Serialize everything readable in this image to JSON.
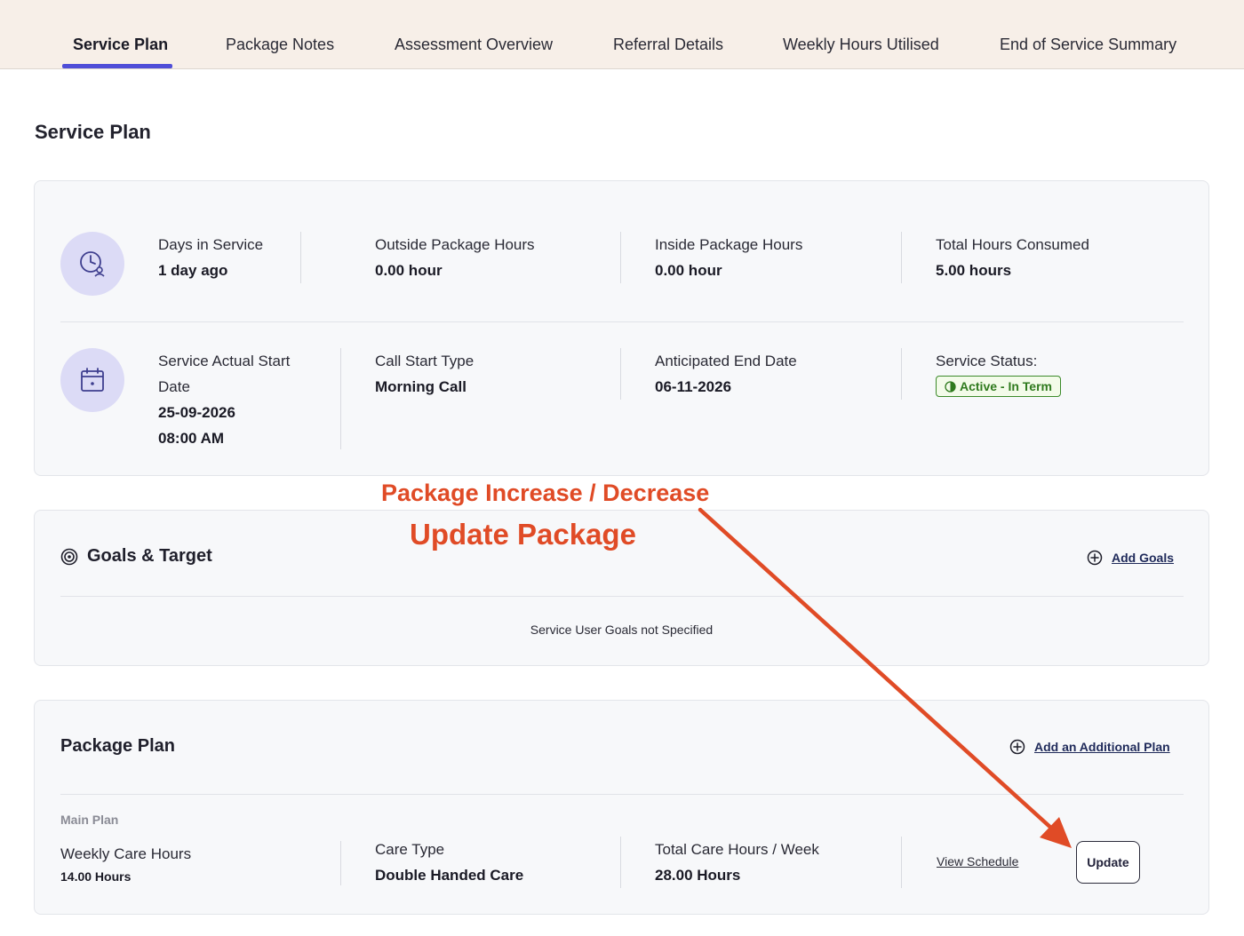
{
  "tabs": [
    {
      "label": "Service Plan",
      "active": true
    },
    {
      "label": "Package Notes",
      "active": false
    },
    {
      "label": "Assessment Overview",
      "active": false
    },
    {
      "label": "Referral Details",
      "active": false
    },
    {
      "label": "Weekly Hours Utilised",
      "active": false
    },
    {
      "label": "End of Service Summary",
      "active": false
    }
  ],
  "page_title": "Service Plan",
  "stats_row1": {
    "days_in_service": {
      "label": "Days in Service",
      "value": "1 day ago"
    },
    "outside_package_hours": {
      "label": "Outside Package Hours",
      "value": "0.00 hour"
    },
    "inside_package_hours": {
      "label": "Inside Package Hours",
      "value": "0.00 hour"
    },
    "total_hours_consumed": {
      "label": "Total Hours Consumed",
      "value": "5.00 hours"
    }
  },
  "stats_row2": {
    "service_actual_start": {
      "label_line1": "Service Actual Start",
      "label_line2": "Date",
      "date": "25-09-2026",
      "time": "08:00 AM"
    },
    "call_start_type": {
      "label": "Call Start Type",
      "value": "Morning Call"
    },
    "anticipated_end_date": {
      "label": "Anticipated End Date",
      "value": "06-11-2026"
    },
    "service_status": {
      "label": "Service Status:",
      "value": "Active - In Term"
    }
  },
  "goals": {
    "title": "Goals & Target",
    "add_label": "Add Goals",
    "empty_text": "Service User Goals not Specified"
  },
  "package_plan": {
    "title": "Package Plan",
    "add_label": "Add an Additional Plan",
    "subhead": "Main Plan",
    "weekly_care_hours": {
      "label": "Weekly Care Hours",
      "value": "14.00 Hours"
    },
    "care_type": {
      "label": "Care Type",
      "value": "Double Handed Care"
    },
    "total_care_hours": {
      "label": "Total Care Hours / Week",
      "value": "28.00 Hours"
    },
    "view_schedule_label": "View Schedule",
    "update_label": "Update"
  },
  "annotation": {
    "line1": "Package Increase / Decrease",
    "line2": "Update Package",
    "color": "#e04b26"
  },
  "colors": {
    "accent": "#4f4ed8",
    "tabbar_bg": "#f7efe8",
    "status_green": "#3c8a2a",
    "icon_circle": "#dcdbf6"
  }
}
